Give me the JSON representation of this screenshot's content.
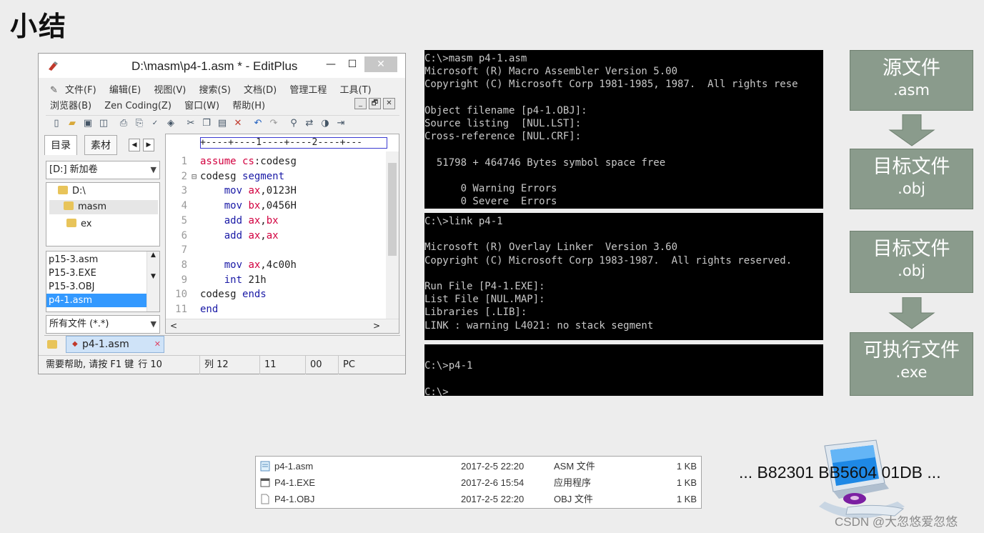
{
  "slide": {
    "title": "小结"
  },
  "editplus": {
    "title": "D:\\masm\\p4-1.asm * - EditPlus",
    "window_buttons": {
      "minimize": "—",
      "maximize": "☐",
      "close": "✕"
    },
    "menu_row1": [
      "文件(F)",
      "编辑(E)",
      "视图(V)",
      "搜索(S)",
      "文档(D)",
      "管理工程",
      "工具(T)"
    ],
    "menu_row2": [
      "浏览器(B)",
      "Zen Coding(Z)",
      "窗口(W)",
      "帮助(H)"
    ],
    "mdi_buttons": [
      "_",
      "🗗",
      "✕"
    ],
    "toolbar_icons": [
      "new-file-icon",
      "open-folder-icon",
      "save-icon",
      "save-all-icon",
      "print-preview-icon",
      "print-icon",
      "spellcheck-icon",
      "browser-icon",
      "cut-icon",
      "copy-icon",
      "paste-icon",
      "delete-icon",
      "undo-icon",
      "redo-icon",
      "find-icon",
      "replace-icon",
      "view-icon",
      "indent-icon"
    ],
    "left_tabs": [
      "目录",
      "素材"
    ],
    "drive_combo": "[D:] 新加卷",
    "dirs": [
      "D:\\",
      "masm",
      "ex"
    ],
    "files": [
      "p15-3.asm",
      "P15-3.EXE",
      "P15-3.OBJ",
      "p4-1.asm"
    ],
    "filter_combo": "所有文件 (*.*)",
    "ruler": "+----+----1----+----2----+---",
    "code": [
      {
        "num": "1",
        "tokens": [
          {
            "t": "assume ",
            "c": "kw"
          },
          {
            "t": "cs",
            "c": "kw"
          },
          {
            "t": ":codesg",
            "c": ""
          }
        ]
      },
      {
        "num": "2",
        "fold": "⊟",
        "tokens": [
          {
            "t": "codesg ",
            "c": ""
          },
          {
            "t": "segment",
            "c": "kw2"
          }
        ]
      },
      {
        "num": "3",
        "tokens": [
          {
            "t": "    mov ",
            "c": "kw2"
          },
          {
            "t": "ax",
            "c": "kw"
          },
          {
            "t": ",0123H",
            "c": ""
          }
        ]
      },
      {
        "num": "4",
        "tokens": [
          {
            "t": "    mov ",
            "c": "kw2"
          },
          {
            "t": "bx",
            "c": "kw"
          },
          {
            "t": ",0456H",
            "c": ""
          }
        ]
      },
      {
        "num": "5",
        "tokens": [
          {
            "t": "    add ",
            "c": "kw2"
          },
          {
            "t": "ax",
            "c": "kw"
          },
          {
            "t": ",",
            "c": ""
          },
          {
            "t": "bx",
            "c": "kw"
          }
        ]
      },
      {
        "num": "6",
        "tokens": [
          {
            "t": "    add ",
            "c": "kw2"
          },
          {
            "t": "ax",
            "c": "kw"
          },
          {
            "t": ",",
            "c": ""
          },
          {
            "t": "ax",
            "c": "kw"
          }
        ]
      },
      {
        "num": "7",
        "tokens": []
      },
      {
        "num": "8",
        "tokens": [
          {
            "t": "    mov ",
            "c": "kw2"
          },
          {
            "t": "ax",
            "c": "kw"
          },
          {
            "t": ",4c00h",
            "c": ""
          }
        ]
      },
      {
        "num": "9",
        "tokens": [
          {
            "t": "    int ",
            "c": "kw2"
          },
          {
            "t": "21h",
            "c": ""
          }
        ]
      },
      {
        "num": "10",
        "tokens": [
          {
            "t": "codesg ",
            "c": ""
          },
          {
            "t": "ends",
            "c": "kw2"
          }
        ]
      },
      {
        "num": "11",
        "tokens": [
          {
            "t": "end",
            "c": "kw2"
          }
        ]
      }
    ],
    "doc_tab": "p4-1.asm",
    "status": [
      "需要帮助, 请按 F1 键",
      "行 10",
      "列 12",
      "11",
      "00",
      "PC"
    ]
  },
  "console_masm": [
    "C:\\>masm p4-1.asm",
    "Microsoft (R) Macro Assembler Version 5.00",
    "Copyright (C) Microsoft Corp 1981-1985, 1987.  All rights rese",
    "",
    "Object filename [p4-1.OBJ]:",
    "Source listing  [NUL.LST]:",
    "Cross-reference [NUL.CRF]:",
    "",
    "  51798 + 464746 Bytes symbol space free",
    "",
    "      0 Warning Errors",
    "      0 Severe  Errors"
  ],
  "console_link": [
    "C:\\>link p4-1",
    "",
    "Microsoft (R) Overlay Linker  Version 3.60",
    "Copyright (C) Microsoft Corp 1983-1987.  All rights reserved.",
    "",
    "Run File [P4-1.EXE]:",
    "List File [NUL.MAP]:",
    "Libraries [.LIB]:",
    "LINK : warning L4021: no stack segment"
  ],
  "console_run": [
    "",
    "C:\\>p4-1",
    "",
    "C:\\>"
  ],
  "flow": [
    {
      "line1": "源文件",
      "line2": ".asm"
    },
    {
      "line1": "目标文件",
      "line2": ".obj"
    },
    {
      "line1": "目标文件",
      "line2": ".obj"
    },
    {
      "line1": "可执行文件",
      "line2": ".exe"
    }
  ],
  "flow_color": "#8a9b8c",
  "explorer_rows": [
    {
      "name": "p4-1.asm",
      "date": "2017-2-5 22:20",
      "type": "ASM 文件",
      "size": "1 KB"
    },
    {
      "name": "P4-1.EXE",
      "date": "2017-2-6 15:54",
      "type": "应用程序",
      "size": "1 KB"
    },
    {
      "name": "P4-1.OBJ",
      "date": "2017-2-5 22:20",
      "type": "OBJ 文件",
      "size": "1 KB"
    }
  ],
  "hex_text": "... B82301 BB5604 01DB ...",
  "watermark": "CSDN @大忽悠爱忽悠"
}
